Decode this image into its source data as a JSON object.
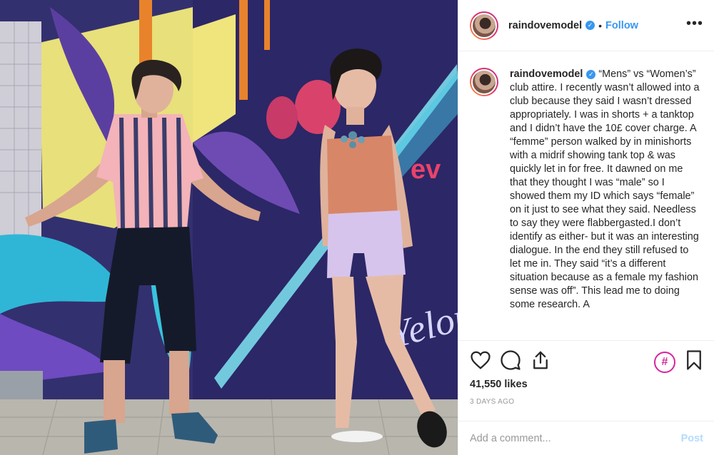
{
  "post": {
    "username": "raindovemodel",
    "verified_icon": "verified-badge-icon",
    "separator": "•",
    "follow_label": "Follow",
    "more_label": "•••"
  },
  "caption": {
    "username": "raindovemodel",
    "text": "“Mens” vs “Women’s” club attire. I recently wasn’t allowed into a club because they said I wasn’t dressed appropriately. I was in shorts + a tanktop and I didn’t have the 10£ cover charge. A “femme” person walked by in minishorts with a midrif showing tank top & was quickly let in for free. It dawned on me that they thought I was “male” so I showed them my ID which says “female” on it just to see what they said. Needless to say they were flabbergasted.I don’t identify as either- but it was an interesting dialogue. In the end they still refused to let me in. They said “it’s a different situation because as a female my fashion sense was off”. This lead me to doing some research. A"
  },
  "actions": {
    "icons": [
      "heart-icon",
      "comment-icon",
      "share-icon",
      "hashtag-icon",
      "bookmark-icon"
    ],
    "hashtag_glyph": "#",
    "likes": "41,550 likes",
    "time_ago": "3 DAYS AGO"
  },
  "comment": {
    "placeholder": "Add a comment...",
    "post_label": "Post"
  },
  "colors": {
    "accent": "#3897f0",
    "post_disabled": "#b3dbff",
    "hashtag": "#d6249f",
    "border": "#efefef"
  }
}
